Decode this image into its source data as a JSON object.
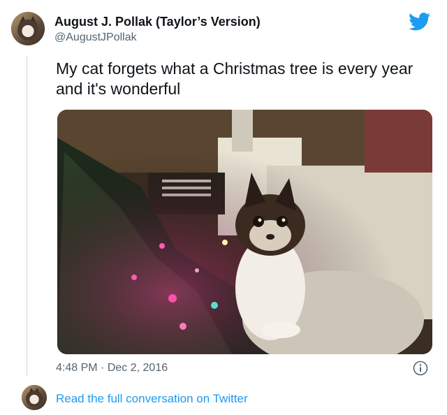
{
  "tweet": {
    "author_name": "August J. Pollak (Taylor’s Version)",
    "author_handle": "@AugustJPollak",
    "text": "My cat forgets what a Christmas tree is every year and it's wonderful",
    "time": "4:48 PM",
    "separator": "·",
    "date": "Dec 2, 2016",
    "photo_description_icon": "cat-christmas-tree-photo"
  },
  "footer": {
    "read_link": "Read the full conversation on Twitter"
  },
  "colors": {
    "twitter_blue": "#1d9bf0",
    "secondary_text": "#536471",
    "primary_text": "#0f1419"
  },
  "icons": [
    "twitter-bird-icon",
    "info-icon"
  ]
}
